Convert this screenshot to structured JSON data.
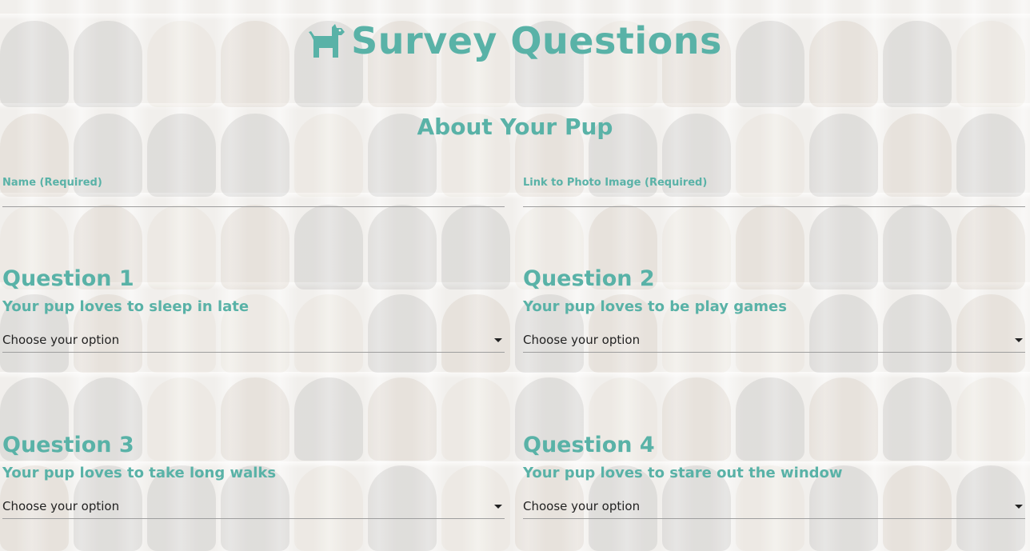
{
  "header": {
    "title": "Survey Questions",
    "icon": "dog-icon"
  },
  "section": {
    "title": "About Your Pup"
  },
  "fields": {
    "name": {
      "label": "Name (Required)",
      "value": ""
    },
    "photo_link": {
      "label": "Link to Photo Image (Required)",
      "value": ""
    }
  },
  "questions": [
    {
      "title": "Question 1",
      "text": "Your pup loves to sleep in late",
      "selected": "Choose your option"
    },
    {
      "title": "Question 2",
      "text": "Your pup loves to be play games",
      "selected": "Choose your option"
    },
    {
      "title": "Question 3",
      "text": "Your pup loves to take long walks",
      "selected": "Choose your option"
    },
    {
      "title": "Question 4",
      "text": "Your pup loves to stare out the window",
      "selected": "Choose your option"
    }
  ],
  "colors": {
    "accent": "#59b2a7",
    "underline": "#9e9e9e",
    "text": "#222222"
  }
}
